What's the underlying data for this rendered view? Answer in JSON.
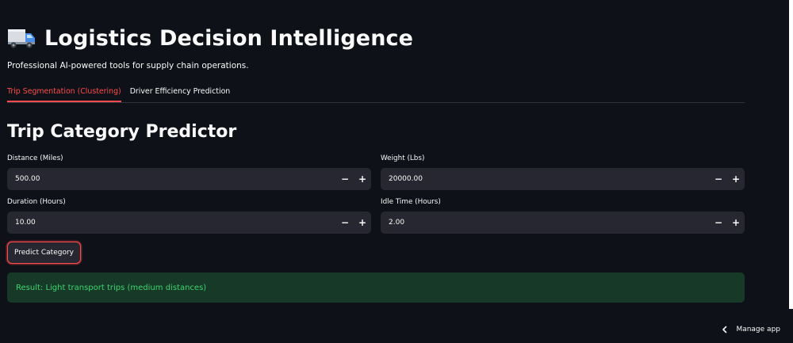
{
  "header": {
    "title": "Logistics Decision Intelligence",
    "icon": "truck-icon",
    "subtitle": "Professional AI-powered tools for supply chain operations."
  },
  "tabs": [
    {
      "label": "Trip Segmentation (Clustering)",
      "active": true
    },
    {
      "label": "Driver Efficiency Prediction",
      "active": false
    }
  ],
  "section": {
    "title": "Trip Category Predictor"
  },
  "fields": {
    "distance": {
      "label": "Distance (Miles)",
      "value": "500.00"
    },
    "weight": {
      "label": "Weight (Lbs)",
      "value": "20000.00"
    },
    "duration": {
      "label": "Duration (Hours)",
      "value": "10.00"
    },
    "idle_time": {
      "label": "Idle Time (Hours)",
      "value": "2.00"
    }
  },
  "stepper": {
    "minus": "−",
    "plus": "+"
  },
  "predict_button": {
    "label": "Predict Category"
  },
  "result": {
    "text": "Result: Light transport trips (medium distances)"
  },
  "footer": {
    "manage_app": "Manage app"
  },
  "colors": {
    "background": "#0e1117",
    "input_bg": "#262730",
    "accent": "#ff4b4b",
    "success_bg": "#173928",
    "success_text": "#3dd56d"
  }
}
